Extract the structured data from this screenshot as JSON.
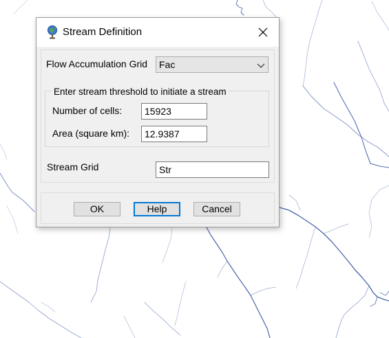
{
  "dialog": {
    "title": "Stream Definition",
    "icon": "globe-pin-icon",
    "close_icon": "close-icon"
  },
  "flow_accumulation": {
    "label": "Flow Accumulation Grid",
    "selected": "Fac"
  },
  "threshold": {
    "legend": "Enter stream threshold to initiate a stream",
    "cells_label": "Number of cells:",
    "cells_value": "15923",
    "area_label": "Area (square km):",
    "area_value": "12.9387"
  },
  "stream_grid": {
    "label": "Stream Grid",
    "value": "Str"
  },
  "buttons": {
    "ok": "OK",
    "help": "Help",
    "cancel": "Cancel"
  },
  "colors": {
    "stream": "#1f3c8c",
    "focus": "#0078d7"
  }
}
